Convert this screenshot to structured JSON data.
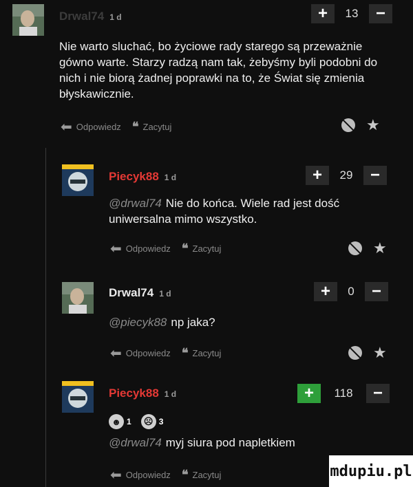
{
  "actions": {
    "reply": "Odpowiedz",
    "quote": "Zacytuj"
  },
  "comments": [
    {
      "author": "Drwal74",
      "time": "1 d",
      "votes": "13",
      "text": "Nie warto sluchać, bo życiowe rady starego są przeważnie gówno warte. Starzy radzą nam tak, żebyśmy byli podobni do nich i nie biorą żadnej poprawki na to, że Świat się zmienia błyskawicznie.",
      "author_color": "#3c3c3c"
    },
    {
      "author": "Piecyk88",
      "time": "1 d",
      "votes": "29",
      "mention": "@drwal74",
      "text": "Nie do końca. Wiele rad jest dość uniwersalna mimo wszystko.",
      "author_color": "#e53935"
    },
    {
      "author": "Drwal74",
      "time": "1 d",
      "votes": "0",
      "mention": "@piecyk88",
      "text": "np jaka?",
      "author_color": "#eaeaea"
    },
    {
      "author": "Piecyk88",
      "time": "1 d",
      "votes": "118",
      "reaction_1": "1",
      "reaction_2": "3",
      "mention": "@drwal74",
      "text": "myj siura pod napletkiem",
      "author_color": "#e53935",
      "plus_active_color": "#2e9f3a"
    }
  ],
  "watermark": "mdupiu.pl"
}
